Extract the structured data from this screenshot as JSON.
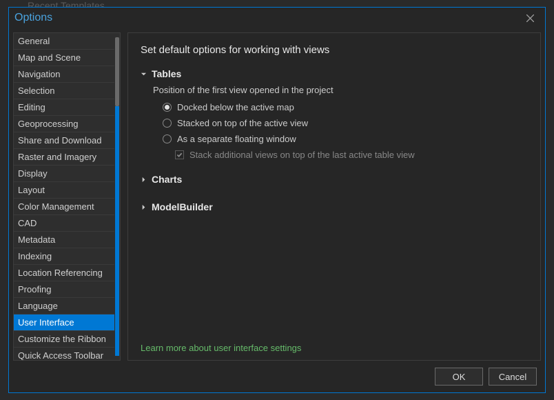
{
  "background": {
    "recentTemplates": "Recent Templates"
  },
  "dialog": {
    "title": "Options",
    "closeLabel": "Close"
  },
  "sidebar": {
    "items": [
      "General",
      "Map and Scene",
      "Navigation",
      "Selection",
      "Editing",
      "Geoprocessing",
      "Share and Download",
      "Raster and Imagery",
      "Display",
      "Layout",
      "Color Management",
      "CAD",
      "Metadata",
      "Indexing",
      "Location Referencing",
      "Proofing",
      "Language",
      "User Interface",
      "Customize the Ribbon",
      "Quick Access Toolbar"
    ],
    "selectedIndex": 17
  },
  "content": {
    "heading": "Set default options for working with views",
    "sections": {
      "tables": {
        "title": "Tables",
        "expanded": true,
        "positionLabel": "Position of the first view opened in the project",
        "radios": [
          {
            "label": "Docked below the active map",
            "checked": true
          },
          {
            "label": "Stacked on top of the active view",
            "checked": false
          },
          {
            "label": "As a separate floating window",
            "checked": false
          }
        ],
        "stackCheckbox": {
          "label": "Stack additional views on top of the last active table view",
          "checked": true,
          "disabled": true
        }
      },
      "charts": {
        "title": "Charts",
        "expanded": false
      },
      "modelBuilder": {
        "title": "ModelBuilder",
        "expanded": false
      }
    },
    "learnMore": "Learn more about user interface settings"
  },
  "footer": {
    "ok": "OK",
    "cancel": "Cancel"
  }
}
